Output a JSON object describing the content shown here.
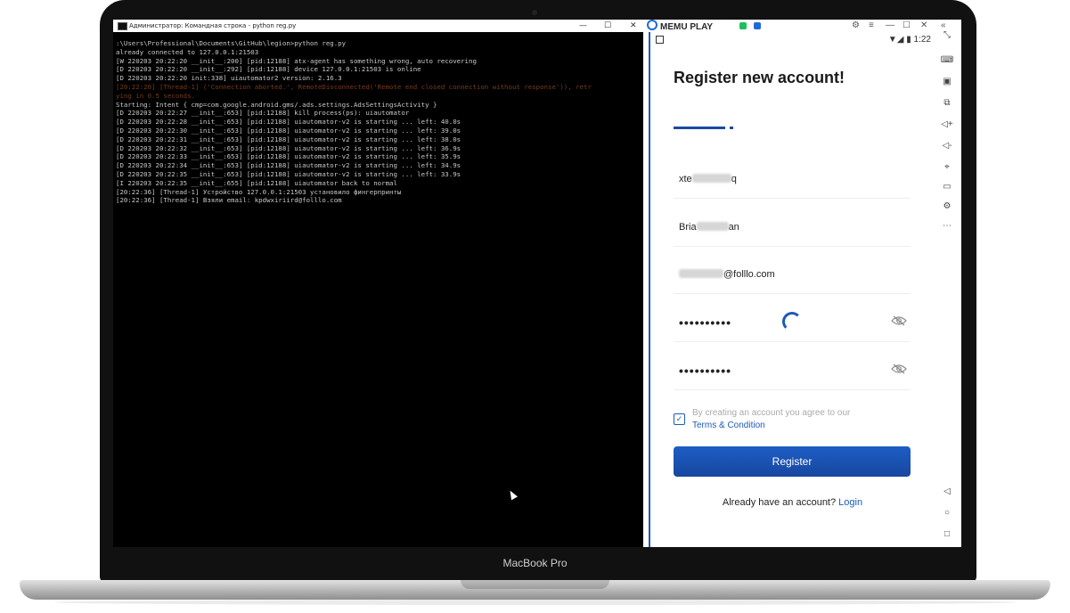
{
  "cmd": {
    "title": "Администратор: Командная строка - python  reg.py",
    "min": "—",
    "max": "☐",
    "close": "✕",
    "lines": [
      {
        "t": ":\\Users\\Professional\\Documents\\GitHub\\legion>python reg.py",
        "c": ""
      },
      {
        "t": "already connected to 127.0.0.1:21503",
        "c": ""
      },
      {
        "t": "[W 220203 20:22:20 __init__:200] [pid:12188] atx-agent has something wrong, auto recovering",
        "c": ""
      },
      {
        "t": "[D 220203 20:22:20 __init__:292] [pid:12188] device 127.0.0.1:21503 is online",
        "c": ""
      },
      {
        "t": "[D 220203 20:22:20 init:338] uiautomator2 version: 2.16.3",
        "c": ""
      },
      {
        "t": "[20:22:20] [Thread-1] ('Connection aborted.', RemoteDisconnected('Remote end closed connection without response')), retr",
        "c": "c-red"
      },
      {
        "t": "ying in 0.5 seconds.",
        "c": "c-red"
      },
      {
        "t": "Starting: Intent { cmp=com.google.android.gms/.ads.settings.AdsSettingsActivity }",
        "c": ""
      },
      {
        "t": "[D 220203 20:22:27 __init__:653] [pid:12188] kill process(ps): uiautomator",
        "c": ""
      },
      {
        "t": "[D 220203 20:22:28 __init__:653] [pid:12188] uiautomator-v2 is starting ... left: 40.0s",
        "c": ""
      },
      {
        "t": "[D 220203 20:22:30 __init__:653] [pid:12188] uiautomator-v2 is starting ... left: 39.0s",
        "c": ""
      },
      {
        "t": "[D 220203 20:22:31 __init__:653] [pid:12188] uiautomator-v2 is starting ... left: 38.0s",
        "c": ""
      },
      {
        "t": "[D 220203 20:22:32 __init__:653] [pid:12188] uiautomator-v2 is starting ... left: 36.9s",
        "c": ""
      },
      {
        "t": "[D 220203 20:22:33 __init__:653] [pid:12188] uiautomator-v2 is starting ... left: 35.9s",
        "c": ""
      },
      {
        "t": "[D 220203 20:22:34 __init__:653] [pid:12188] uiautomator-v2 is starting ... left: 34.9s",
        "c": ""
      },
      {
        "t": "[D 220203 20:22:35 __init__:653] [pid:12188] uiautomator-v2 is starting ... left: 33.9s",
        "c": ""
      },
      {
        "t": "[I 220203 20:22:35 __init__:655] [pid:12188] uiautomator back to normal",
        "c": ""
      },
      {
        "t": "[20:22:36] [Thread-1] Устройство 127.0.0.1:21503 установило фингерпринты",
        "c": ""
      },
      {
        "t": "[20:22:36] [Thread-1] Взяли email: kpdwxiriird@folllo.com",
        "c": ""
      }
    ]
  },
  "emulator": {
    "logo": "MEMU PLAY",
    "controls": [
      "⚙",
      "≡",
      "—",
      "☐",
      "✕",
      "«"
    ],
    "status_time": "1:22",
    "status_icons": "▼◢ ▮",
    "title": "Register new account!",
    "fields": [
      {
        "prefix": "xte",
        "suffix": "q",
        "type": "text"
      },
      {
        "prefix": "Bria",
        "suffix": "an",
        "type": "text"
      },
      {
        "prefix": "",
        "suffix": "@folllo.com",
        "type": "text"
      },
      {
        "prefix": "••••••••••",
        "suffix": "",
        "type": "password"
      },
      {
        "prefix": "••••••••••",
        "suffix": "",
        "type": "password"
      }
    ],
    "agree_text": "By creating an account you agree to our",
    "terms_text": "Terms & Condition",
    "checkbox_mark": "✓",
    "register_label": "Register",
    "have_account": "Already have an account?",
    "login_label": "Login",
    "sidebar_icons": [
      "⤡",
      "⌨",
      "▣",
      "⧉",
      "◁+",
      "◁-",
      "⌖",
      "▭",
      "⚙",
      "⋯",
      "◁",
      "○",
      "□"
    ]
  },
  "brand": "MacBook Pro",
  "colors": {
    "accent": "#1b5bb8",
    "terminal_bg": "#000000",
    "bezel": "#111111"
  }
}
